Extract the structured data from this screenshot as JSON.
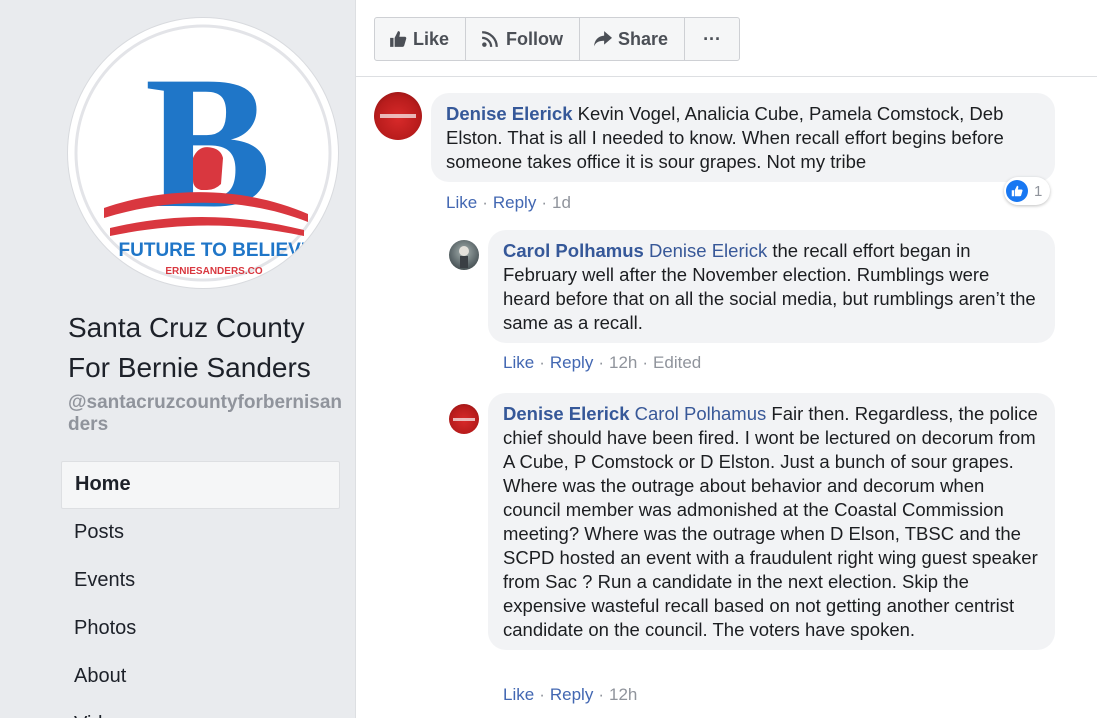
{
  "page": {
    "name_line1": "Santa Cruz County",
    "name_line2": "For Bernie Sanders",
    "handle": "@santacruzcountyforbernisanders",
    "logo": {
      "letter": "B",
      "tagline": "FUTURE TO BELIEVE",
      "url_fragment": "ERNIESANDERS.CO"
    },
    "nav": [
      "Home",
      "Posts",
      "Events",
      "Photos",
      "About",
      "Videos"
    ]
  },
  "actions": {
    "like": "Like",
    "follow": "Follow",
    "share": "Share",
    "more": "···"
  },
  "comments": [
    {
      "author": "Denise Elerick",
      "text": "Kevin Vogel, Analicia Cube, Pamela Comstock, Deb Elston. That is all I needed to know. When recall effort begins before someone takes office it is sour grapes. Not my tribe",
      "like": "Like",
      "reply": "Reply",
      "time": "1d",
      "reactions": "1"
    },
    {
      "author": "Carol Polhamus",
      "mention": "Denise Elerick",
      "text": "the recall effort began in February well after the November election. Rumblings were heard before that on all the social media, but rumblings aren’t the same as a recall.",
      "like": "Like",
      "reply": "Reply",
      "time": "12h",
      "edited": "Edited"
    },
    {
      "author": "Denise Elerick",
      "mention": "Carol Polhamus",
      "text": "Fair then. Regardless, the police chief should have been fired. I wont be lectured on decorum from A Cube, P Comstock or D Elston. Just a bunch of sour grapes. Where was the outrage about behavior and decorum when council member was admonished at the Coastal Commission meeting? Where was the outrage when D Elson, TBSC and the SCPD hosted an event with a fraudulent right wing guest speaker from Sac ? Run a candidate in the next election. Skip the expensive wasteful recall based on not getting another centrist candidate on the council. The voters have spoken.",
      "like": "Like",
      "reply": "Reply",
      "time": "12h"
    }
  ],
  "colors": {
    "link": "#365899",
    "meta_link": "#4267b2",
    "sidebar_bg": "#e9ebee",
    "bubble_bg": "#f2f3f5",
    "logo_blue": "#1f76c8",
    "logo_red": "#d9373f"
  }
}
